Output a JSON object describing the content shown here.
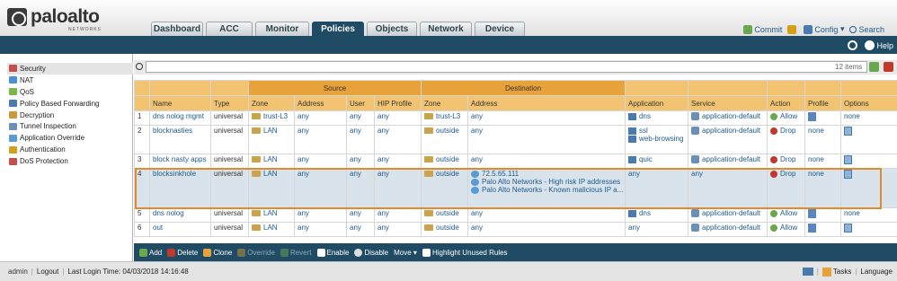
{
  "brand": {
    "name": "paloalto",
    "sub": "NETWORKS"
  },
  "tabs": [
    "Dashboard",
    "ACC",
    "Monitor",
    "Policies",
    "Objects",
    "Network",
    "Device"
  ],
  "active_tab": "Policies",
  "top_actions": {
    "commit": "Commit",
    "config": "Config",
    "search": "Search"
  },
  "help": "Help",
  "sidebar": [
    {
      "label": "Security",
      "color": "#c0504d"
    },
    {
      "label": "NAT",
      "color": "#4a90d9"
    },
    {
      "label": "QoS",
      "color": "#7ab648"
    },
    {
      "label": "Policy Based Forwarding",
      "color": "#4a7bb0"
    },
    {
      "label": "Decryption",
      "color": "#c89a3a"
    },
    {
      "label": "Tunnel Inspection",
      "color": "#6a8fb8"
    },
    {
      "label": "Application Override",
      "color": "#5b9bd5"
    },
    {
      "label": "Authentication",
      "color": "#d4a017"
    },
    {
      "label": "DoS Protection",
      "color": "#c0504d"
    }
  ],
  "search": {
    "count": "12 items"
  },
  "table": {
    "groups": {
      "source": "Source",
      "destination": "Destination"
    },
    "headers": [
      "Name",
      "Type",
      "Zone",
      "Address",
      "User",
      "HIP Profile",
      "Zone",
      "Address",
      "Application",
      "Service",
      "Action",
      "Profile",
      "Options"
    ],
    "rows": [
      {
        "num": "1",
        "name": "dns nolog mgmt",
        "type": "universal",
        "szone": "trust-L3",
        "saddr": "any",
        "user": "any",
        "hip": "any",
        "dzone": "trust-L3",
        "daddr": [
          "any"
        ],
        "app": [
          "dns"
        ],
        "svc": "application-default",
        "action": "Allow",
        "profile": "",
        "options": "none"
      },
      {
        "num": "2",
        "name": "blocknasties",
        "type": "universal",
        "szone": "LAN",
        "saddr": "any",
        "user": "any",
        "hip": "any",
        "dzone": "outside",
        "daddr": [
          "any"
        ],
        "app": [
          "ssl",
          "web-browsing"
        ],
        "svc": "application-default",
        "action": "Drop",
        "profile": "none",
        "options": ""
      },
      {
        "num": "3",
        "name": "block nasty apps",
        "type": "universal",
        "szone": "LAN",
        "saddr": "any",
        "user": "any",
        "hip": "any",
        "dzone": "outside",
        "daddr": [
          "any"
        ],
        "app": [
          "quic"
        ],
        "svc": "application-default",
        "action": "Drop",
        "profile": "none",
        "options": ""
      },
      {
        "num": "4",
        "name": "blocksinkhole",
        "type": "universal",
        "szone": "LAN",
        "saddr": "any",
        "user": "any",
        "hip": "any",
        "dzone": "outside",
        "daddr": [
          "72.5.65.111",
          "Palo Alto Networks - High risk IP addresses",
          "Palo Alto Networks - Known malicious IP a..."
        ],
        "app": [
          "any"
        ],
        "svc": "any",
        "action": "Drop",
        "profile": "none",
        "options": ""
      },
      {
        "num": "5",
        "name": "dns nolog",
        "type": "universal",
        "szone": "LAN",
        "saddr": "any",
        "user": "any",
        "hip": "any",
        "dzone": "outside",
        "daddr": [
          "any"
        ],
        "app": [
          "dns"
        ],
        "svc": "application-default",
        "action": "Allow",
        "profile": "",
        "options": "none"
      },
      {
        "num": "6",
        "name": "out",
        "type": "universal",
        "szone": "LAN",
        "saddr": "any",
        "user": "any",
        "hip": "any",
        "dzone": "outside",
        "daddr": [
          "any"
        ],
        "app": [
          "any"
        ],
        "svc": "application-default",
        "action": "Allow",
        "profile": "",
        "options": ""
      }
    ]
  },
  "footer": [
    "Add",
    "Delete",
    "Clone",
    "Override",
    "Revert",
    "Enable",
    "Disable",
    "Move",
    "Highlight Unused Rules"
  ],
  "status": {
    "user": "admin",
    "logout": "Logout",
    "login": "Last Login Time: 04/03/2018 14:16:48",
    "tasks": "Tasks",
    "language": "Language"
  }
}
